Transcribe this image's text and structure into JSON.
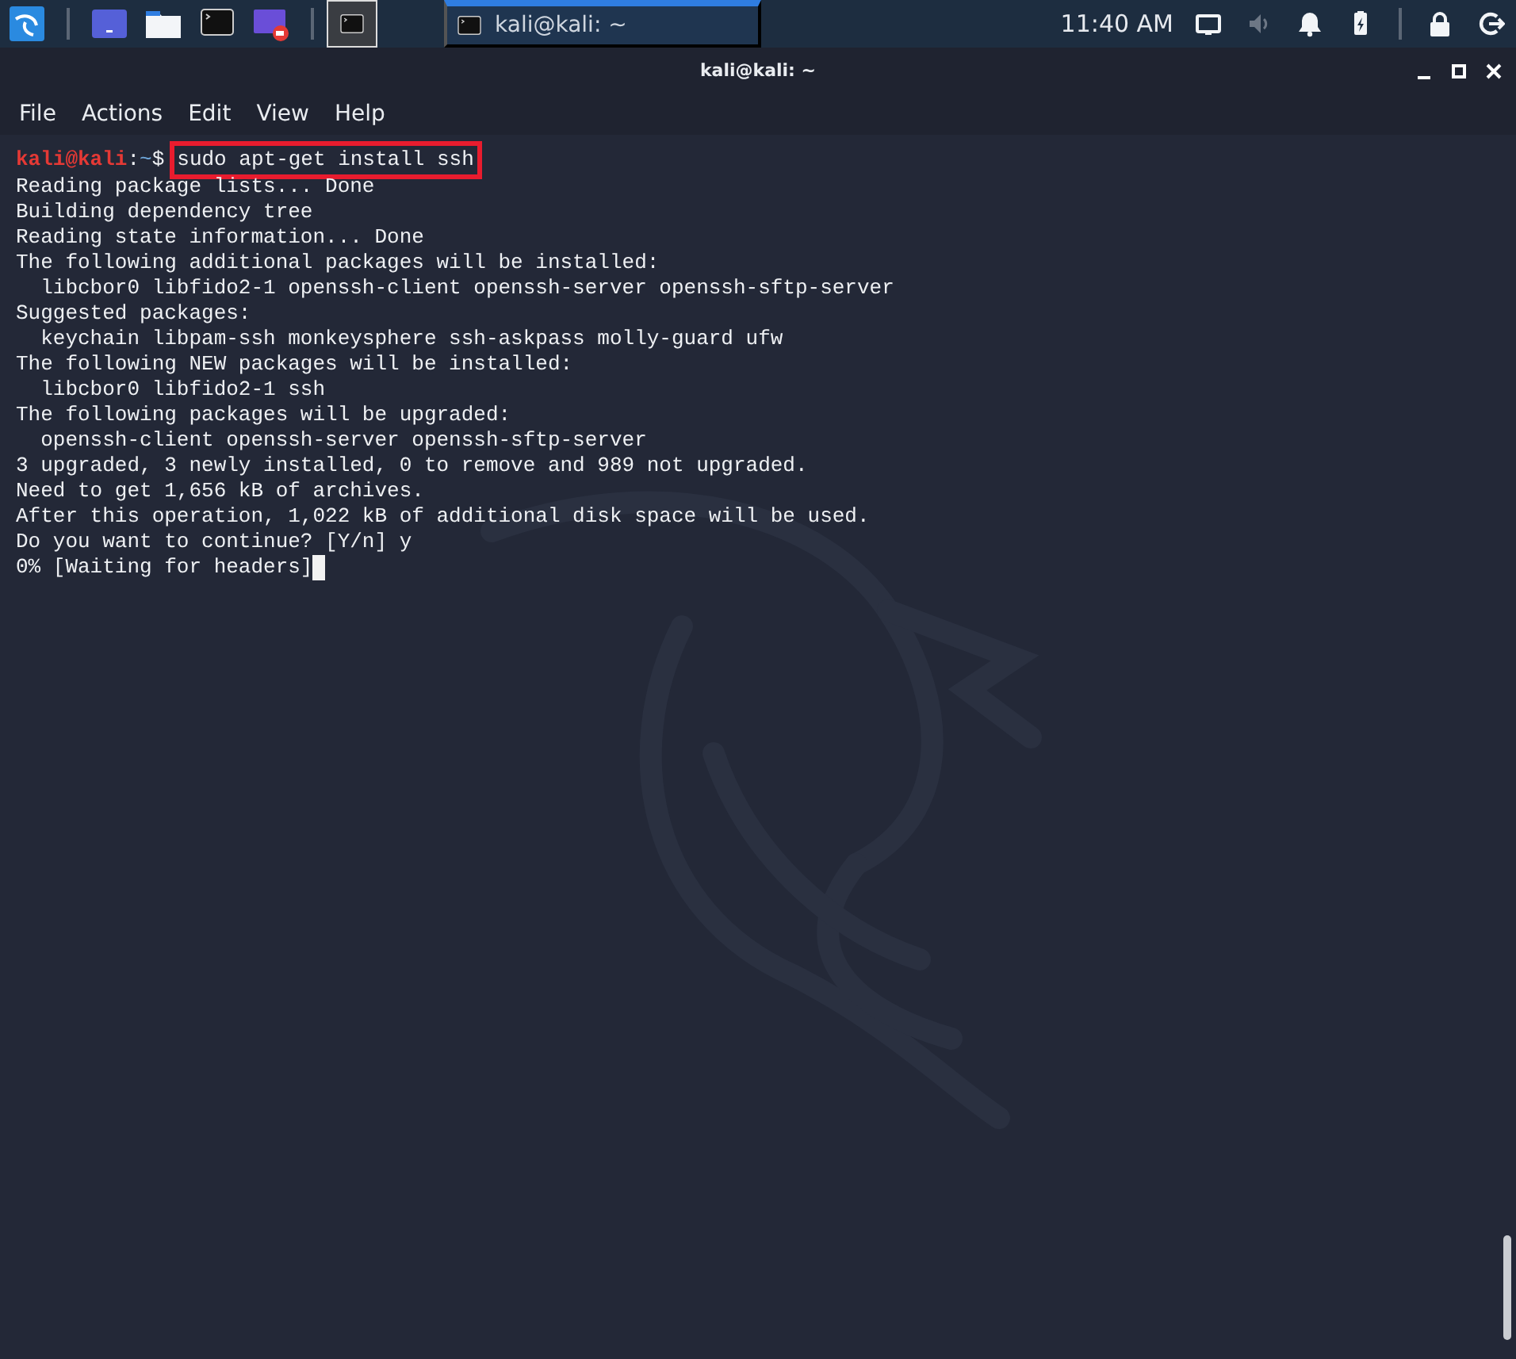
{
  "taskbar": {
    "launchers": [
      {
        "kind": "menu"
      },
      {
        "kind": "workspace"
      },
      {
        "kind": "files"
      },
      {
        "kind": "terminal"
      },
      {
        "kind": "recorder"
      }
    ],
    "workspaces": [
      {
        "selected": true
      }
    ],
    "tasks": [
      {
        "title": "kali@kali: ~",
        "selected": true
      }
    ],
    "clock": "11:40 AM",
    "tray": [
      {
        "kind": "display",
        "muted": false
      },
      {
        "kind": "volume",
        "muted": true
      },
      {
        "kind": "bell",
        "muted": false
      },
      {
        "kind": "battery",
        "muted": false
      },
      {
        "kind": "lock",
        "muted": false
      },
      {
        "kind": "logout",
        "muted": false
      }
    ]
  },
  "window": {
    "title": "kali@kali: ~"
  },
  "menu": [
    "File",
    "Actions",
    "Edit",
    "View",
    "Help"
  ],
  "terminal": {
    "prompt": {
      "user": "kali@kali",
      "separator": ":",
      "path": "~",
      "symbol": "$",
      "command": "sudo apt-get install ssh",
      "highlighted": true
    },
    "lines": [
      "Reading package lists... Done",
      "Building dependency tree",
      "Reading state information... Done",
      "The following additional packages will be installed:",
      "  libcbor0 libfido2-1 openssh-client openssh-server openssh-sftp-server",
      "Suggested packages:",
      "  keychain libpam-ssh monkeysphere ssh-askpass molly-guard ufw",
      "The following NEW packages will be installed:",
      "  libcbor0 libfido2-1 ssh",
      "The following packages will be upgraded:",
      "  openssh-client openssh-server openssh-sftp-server",
      "3 upgraded, 3 newly installed, 0 to remove and 989 not upgraded.",
      "Need to get 1,656 kB of archives.",
      "After this operation, 1,022 kB of additional disk space will be used.",
      "Do you want to continue? [Y/n] y",
      "0% [Waiting for headers]"
    ],
    "cursor": true
  }
}
